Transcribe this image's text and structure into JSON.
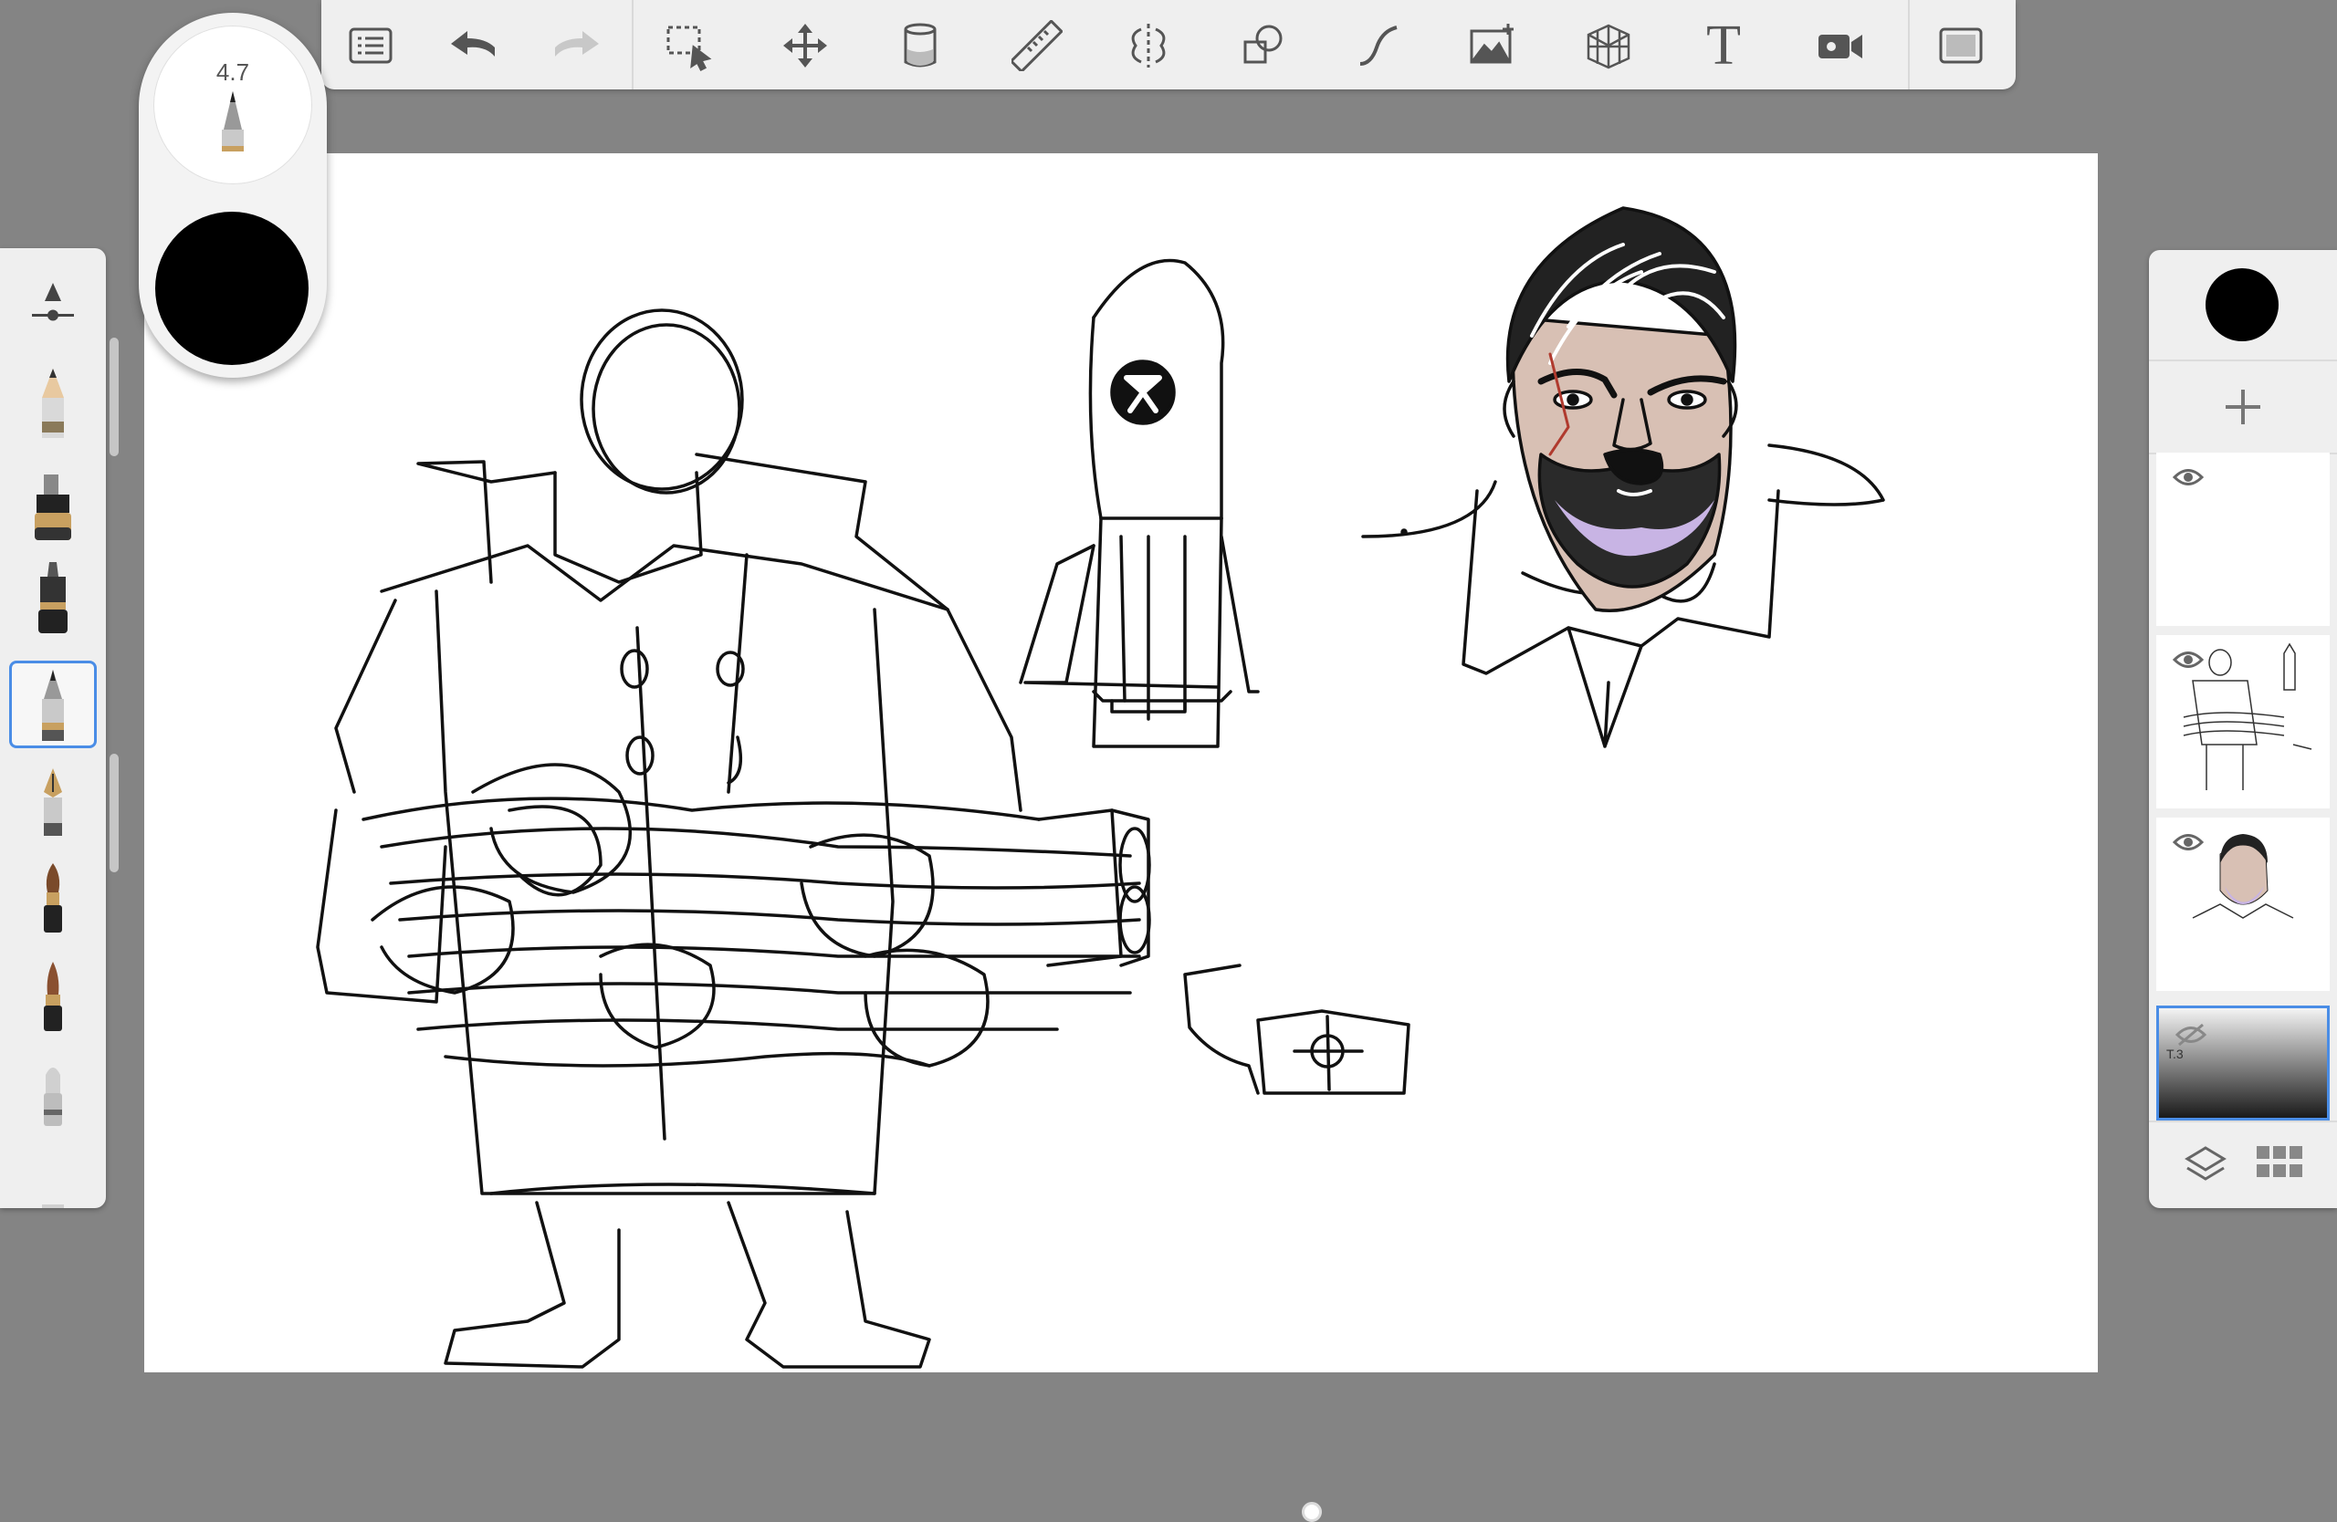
{
  "brush": {
    "size_label": "4.7",
    "color": "#000000"
  },
  "toolbar": {
    "tools": [
      "layers-list-icon",
      "undo-icon",
      "redo-icon",
      "selection-icon",
      "transform-icon",
      "fill-icon",
      "ruler-icon",
      "symmetry-icon",
      "shape-icon",
      "stroke-icon",
      "image-icon",
      "perspective-icon",
      "text-icon",
      "timelapse-icon",
      "fullscreen-icon"
    ],
    "text_tool_label": "T"
  },
  "palette": {
    "brushes": [
      "size-slider",
      "pencil",
      "marker",
      "inking-pen",
      "ballpoint-pen",
      "fountain-pen",
      "paint-brush",
      "round-brush",
      "eraser"
    ],
    "selected_index": 4
  },
  "layers": {
    "add_label": "+",
    "items": [
      {
        "name": "layer-empty",
        "visible": true
      },
      {
        "name": "layer-sketch",
        "visible": true
      },
      {
        "name": "layer-portrait",
        "visible": true
      },
      {
        "name": "layer-background",
        "visible": false,
        "selected": true
      }
    ],
    "background_label": "T.3"
  },
  "colors": {
    "accent": "#4a8de6",
    "panel": "#efefef",
    "workspace": "#848484"
  }
}
